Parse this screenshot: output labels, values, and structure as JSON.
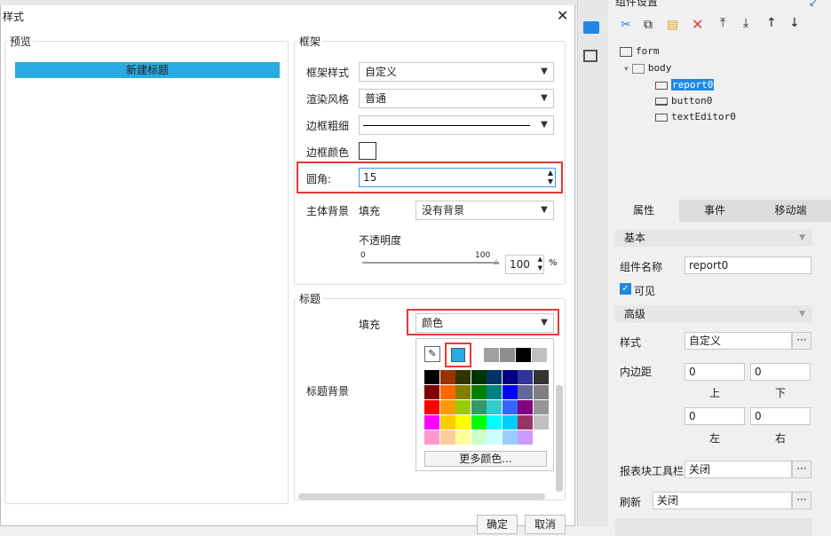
{
  "dialog": {
    "title": "样式",
    "preview_label": "预览",
    "preview_heading": "新建标题",
    "frame": {
      "section_label": "框架",
      "frame_style_label": "框架样式",
      "frame_style_value": "自定义",
      "render_style_label": "渲染风格",
      "render_style_value": "普通",
      "border_width_label": "边框粗细",
      "border_color_label": "边框颜色",
      "radius_label": "圆角:",
      "radius_value": "15",
      "body_bg_label": "主体背景",
      "fill_label": "填充",
      "fill_value": "没有背景",
      "opacity_label": "不透明度",
      "slider_min": "0",
      "slider_max": "100",
      "opacity_value": "100",
      "opacity_unit": "%"
    },
    "title_section": {
      "section_label": "标题",
      "fill_label": "填充",
      "fill_value": "颜色",
      "title_bg_label": "标题背景",
      "more_colors": "更多颜色..."
    },
    "ok_button": "确定",
    "cancel_button": "取消"
  },
  "right_panel": {
    "header": "组件设置",
    "tree": {
      "form": "form",
      "body": "body",
      "children": [
        "report0",
        "button0",
        "textEditor0"
      ]
    },
    "tabs": [
      "属性",
      "事件",
      "移动端"
    ],
    "basic_section": "基本",
    "component_name_label": "组件名称",
    "component_name_value": "report0",
    "visible_label": "可见",
    "advanced_section": "高级",
    "style_label": "样式",
    "style_value": "自定义",
    "padding_label": "内边距",
    "padding_top": "0",
    "padding_bottom": "0",
    "padding_left": "0",
    "padding_right": "0",
    "top_label": "上",
    "bottom_label": "下",
    "left_label": "左",
    "right_label": "右",
    "toolbar_label": "报表块工具栏",
    "toolbar_value": "关闭",
    "refresh_label": "刷新",
    "refresh_value": "关闭",
    "dots": "···"
  },
  "colors": {
    "accent": "#29abe2",
    "highlight": "#e53935"
  }
}
